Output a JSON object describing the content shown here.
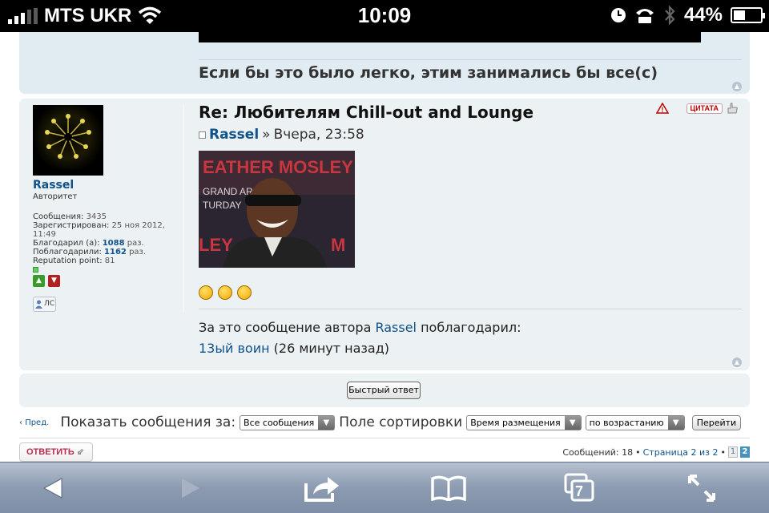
{
  "status_bar": {
    "carrier": "MTS UKR",
    "time": "10:09",
    "battery": "44%",
    "battery_level": 0.44
  },
  "previous_post": {
    "signature": "Если бы это было легко, этим занимались бы все(с)"
  },
  "post": {
    "title": "Re: Любителям Chill-out and Lounge",
    "author": "Rassel",
    "separator": "»",
    "date": "Вчера, 23:58",
    "quote_label": "ЦИТАТА",
    "profile": {
      "username": "Rassel",
      "rank": "Авторитет",
      "posts_label": "Сообщения:",
      "posts": "3435",
      "registered_label": "Зарегистрирован:",
      "registered": "25 ноя 2012, 11:49",
      "thanked_label": "Благодарил (а):",
      "thanked": "1088",
      "thanked_suffix": "раз.",
      "thanks_received_label": "Поблагодарили:",
      "thanks_received": "1162",
      "thanks_received_suffix": "раз.",
      "reputation_label": "Reputation point:",
      "reputation": "81",
      "pm_label": "ЛС"
    },
    "thanks": {
      "text": "За это сообщение автора",
      "author": "Rassel",
      "verb": "поблагодарил:",
      "user": "13ый воин",
      "when": "(26 минут назад)"
    }
  },
  "quick_reply_label": "Быстрый ответ",
  "sort_bar": {
    "prev_label": "Пред.",
    "show_label": "Показать сообщения за:",
    "show_value": "Все сообщения",
    "sort_label": "Поле сортировки",
    "sort_field": "Время размещения",
    "sort_order": "по возрастанию",
    "go_label": "Перейти"
  },
  "reply_label": "ОТВЕТИТЬ",
  "pagination": {
    "count_text": "Сообщений: 18",
    "bullet": "•",
    "page_text": "Страница 2 из 2",
    "pages": [
      "1",
      "2"
    ]
  },
  "toolbar": {
    "tabs_count": "7"
  }
}
